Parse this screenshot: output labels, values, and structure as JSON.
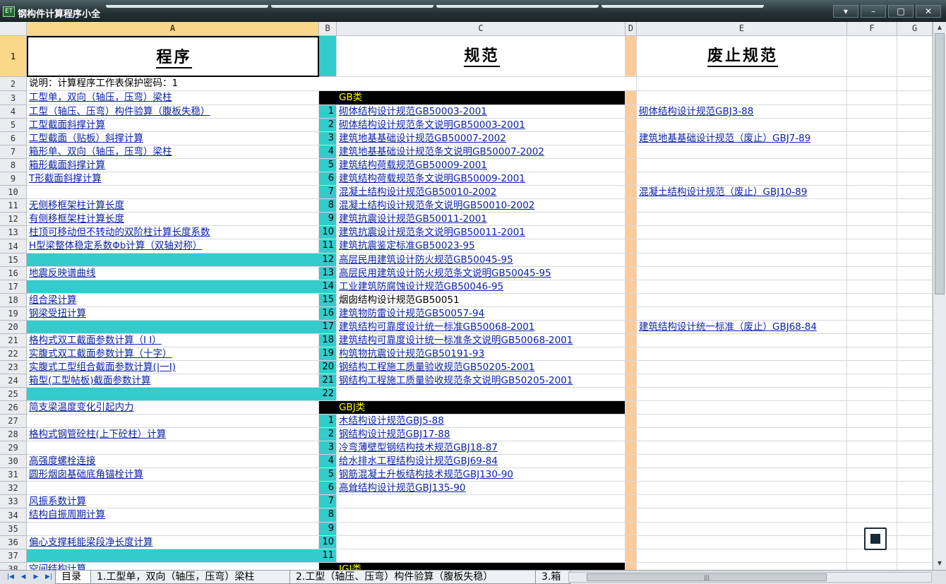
{
  "window": {
    "title": "钢构件计算程序小全",
    "app_icon": "excel-icon",
    "buttons": [
      "▾",
      "–",
      "□",
      "✕"
    ]
  },
  "columns": [
    "A",
    "B",
    "C",
    "D",
    "E",
    "F",
    "G"
  ],
  "selected_column": "A",
  "headers": {
    "program": "程序",
    "standard": "规范",
    "obsolete": "废止规范"
  },
  "note": "说明：计算程序工作表保护密码：1",
  "programs": [
    {
      "row": 3,
      "text": "工型单，双向（轴压，压弯）梁柱"
    },
    {
      "row": 4,
      "text": "工型（轴压、压弯）构件验算（腹板失稳）"
    },
    {
      "row": 5,
      "text": "工型截面斜撑计算"
    },
    {
      "row": 6,
      "text": "工型截面（贴板）斜撑计算"
    },
    {
      "row": 7,
      "text": "箱形单、双向（轴压，压弯）梁柱"
    },
    {
      "row": 8,
      "text": "箱形截面斜撑计算"
    },
    {
      "row": 9,
      "text": "T形截面斜撑计算"
    },
    {
      "row": 11,
      "text": "无侧移框架柱计算长度"
    },
    {
      "row": 12,
      "text": "有侧移框架柱计算长度"
    },
    {
      "row": 13,
      "text": "柱顶可移动但不转动的双阶柱计算长度系数"
    },
    {
      "row": 14,
      "text": "H型梁整体稳定系数Φb计算（双轴对称）"
    },
    {
      "row": 16,
      "text": "地震反映谱曲线"
    },
    {
      "row": 18,
      "text": "组合梁计算"
    },
    {
      "row": 19,
      "text": "钢梁受扭计算"
    },
    {
      "row": 21,
      "text": "格构式双工截面参数计算（I  I）"
    },
    {
      "row": 22,
      "text": "实腹式双工截面参数计算（十字）"
    },
    {
      "row": 23,
      "text": "实腹式工型组合截面参数计算(|一I)"
    },
    {
      "row": 24,
      "text": "箱型(工型帖板)截面参数计算"
    },
    {
      "row": 26,
      "text": "简支梁温度变化引起内力"
    },
    {
      "row": 28,
      "text": "格构式钢管砼柱(上下砼柱）计算"
    },
    {
      "row": 30,
      "text": "高强度螺栓连接"
    },
    {
      "row": 31,
      "text": "圆形烟囱基础底角锚栓计算"
    },
    {
      "row": 33,
      "text": "风振系数计算"
    },
    {
      "row": 34,
      "text": "结构自振周期计算"
    },
    {
      "row": 36,
      "text": "偏心支撑耗能梁段净长度计算"
    }
  ],
  "teal_rows_a": [
    15,
    17,
    20,
    25,
    37
  ],
  "gb_header": "GB类",
  "gbj_header": "GBJ类",
  "next_header": "JGJ类",
  "standards_gb": [
    {
      "row": 4,
      "no": "1",
      "text": "砌体结构设计规范GB50003-2001"
    },
    {
      "row": 5,
      "no": "2",
      "text": "砌体结构设计规范条文说明GB50003-2001"
    },
    {
      "row": 6,
      "no": "3",
      "text": "建筑地基基础设计规范GB50007-2002"
    },
    {
      "row": 7,
      "no": "4",
      "text": "建筑地基基础设计规范条文说明GB50007-2002"
    },
    {
      "row": 8,
      "no": "5",
      "text": "建筑结构荷载规范GB50009-2001"
    },
    {
      "row": 9,
      "no": "6",
      "text": "建筑结构荷载规范条文说明GB50009-2001"
    },
    {
      "row": 10,
      "no": "7",
      "text": "混凝土结构设计规范GB50010-2002"
    },
    {
      "row": 11,
      "no": "8",
      "text": "混凝土结构设计规范条文说明GB50010-2002"
    },
    {
      "row": 12,
      "no": "9",
      "text": "建筑抗震设计规范GB50011-2001"
    },
    {
      "row": 13,
      "no": "10",
      "text": "建筑抗震设计规范条文说明GB50011-2001"
    },
    {
      "row": 14,
      "no": "11",
      "text": "建筑抗震鉴定标准GB50023-95"
    },
    {
      "row": 15,
      "no": "12",
      "text": "高层民用建筑设计防火规范GB50045-95"
    },
    {
      "row": 16,
      "no": "13",
      "text": "高层民用建筑设计防火规范条文说明GB50045-95"
    },
    {
      "row": 17,
      "no": "14",
      "text": "工业建筑防腐蚀设计规范GB50046-95"
    },
    {
      "row": 18,
      "no": "15",
      "text": "烟囱结构设计规范GB50051",
      "plain": true
    },
    {
      "row": 19,
      "no": "16",
      "text": "建筑物防雷设计规范GB50057-94"
    },
    {
      "row": 20,
      "no": "17",
      "text": "建筑结构可靠度设计统一标准GB50068-2001"
    },
    {
      "row": 21,
      "no": "18",
      "text": "建筑结构可靠度设计统一标准条文说明GB50068-2001"
    },
    {
      "row": 22,
      "no": "19",
      "text": "构筑物抗震设计规范GB50191-93"
    },
    {
      "row": 23,
      "no": "20",
      "text": "钢结构工程施工质量验收规范GB50205-2001"
    },
    {
      "row": 24,
      "no": "21",
      "text": "钢结构工程施工质量验收规范条文说明GB50205-2001"
    },
    {
      "row": 25,
      "no": "22",
      "text": ""
    }
  ],
  "standards_gbj": [
    {
      "row": 27,
      "no": "1",
      "text": "木结构设计规范GBJ5-88"
    },
    {
      "row": 28,
      "no": "2",
      "text": "钢结构设计规范GBJ17-88"
    },
    {
      "row": 29,
      "no": "3",
      "text": "冷弯薄壁型钢结构技术规范GBJ18-87"
    },
    {
      "row": 30,
      "no": "4",
      "text": "给水排水工程结构设计规范GBJ69-84"
    },
    {
      "row": 31,
      "no": "5",
      "text": "钢筋混凝土升板结构技术规范GBJ130-90"
    },
    {
      "row": 32,
      "no": "6",
      "text": "高耸结构设计规范GBJ135-90"
    },
    {
      "row": 33,
      "no": "7",
      "text": ""
    },
    {
      "row": 34,
      "no": "8",
      "text": ""
    },
    {
      "row": 35,
      "no": "9",
      "text": ""
    },
    {
      "row": 36,
      "no": "10",
      "text": ""
    },
    {
      "row": 37,
      "no": "11",
      "text": ""
    }
  ],
  "obsolete": [
    {
      "row": 4,
      "text": "砌体结构设计规范GBJ3-88"
    },
    {
      "row": 6,
      "text": "建筑地基基础设计规范（废止）GBJ7-89"
    },
    {
      "row": 10,
      "text": "混凝土结构设计规范（废止）GBJ10-89"
    },
    {
      "row": 20,
      "text": "建筑结构设计统一标准（废止）GBJ68-84"
    }
  ],
  "row38_text": "空间结构计算",
  "sheet_tabs": [
    {
      "label": "目录",
      "active": true
    },
    {
      "label": "1.工型单，双向（轴压，压弯）梁柱",
      "active": false
    },
    {
      "label": "2.工型（轴压、压弯）构件验算（腹板失稳）",
      "active": false
    },
    {
      "label": "3.箱",
      "active": false
    }
  ],
  "colors": {
    "teal": "#33cccc",
    "peach": "#ffcc99",
    "link": "#0b21a8",
    "section_bg": "#000000",
    "section_text": "#ffff00"
  }
}
